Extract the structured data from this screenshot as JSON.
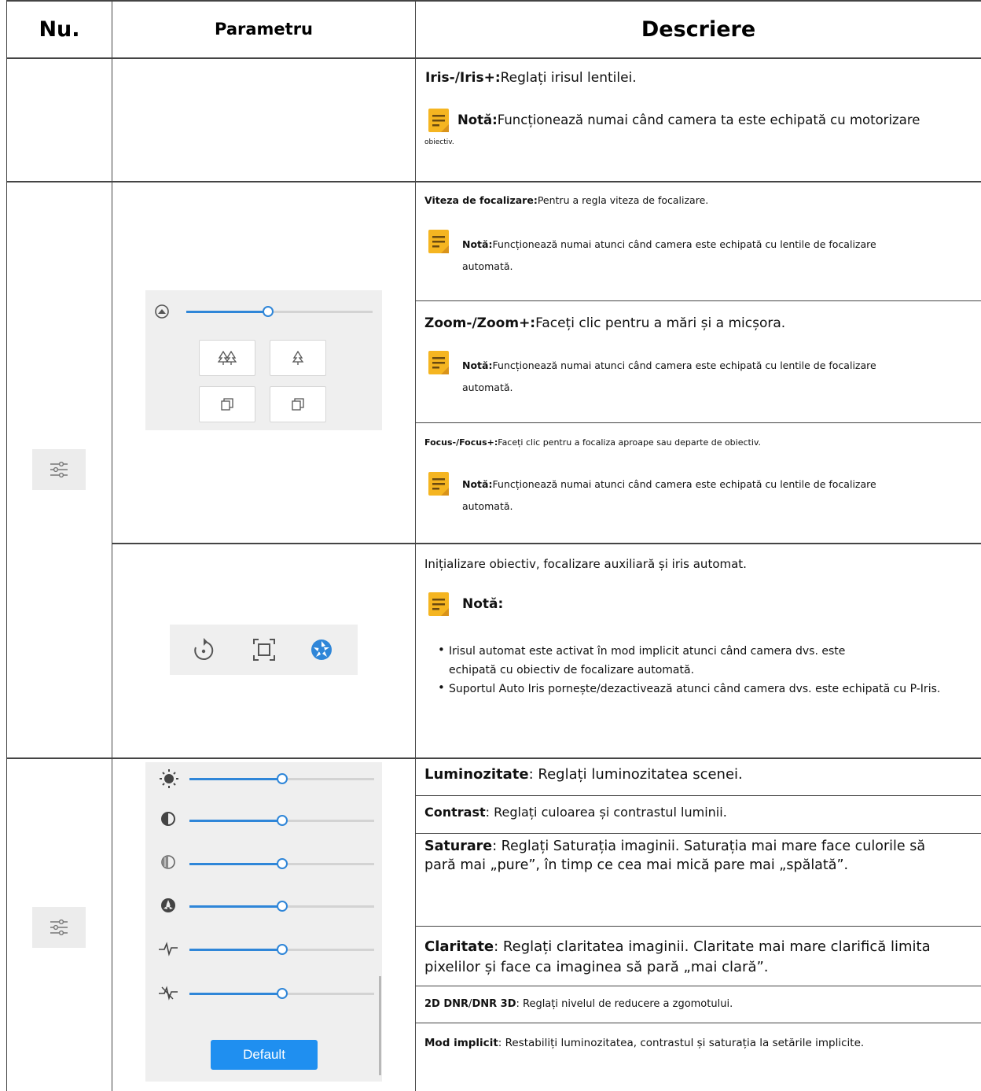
{
  "header": {
    "col_no": "Nu.",
    "col_param": "Parametru",
    "col_desc": "Descriere"
  },
  "rows": {
    "iris": {
      "label": "Iris-/Iris+:",
      "text": "Reglați irisul lentilei.",
      "note_label": "Notă:",
      "note_text": "Funcționează numai când camera ta este echipată cu motorizare",
      "note_cont": "obiectiv."
    },
    "focus_speed": {
      "label": "Viteza de focalizare:",
      "text": "Pentru a regla viteza de focalizare.",
      "note_label": "Notă:",
      "note_text": "Funcționează numai atunci când camera este echipată cu lentile de focalizare",
      "note_cont": "automată."
    },
    "zoom": {
      "label": "Zoom-/Zoom+:",
      "text": "Faceți clic pentru a mări și a micșora.",
      "note_label": "Notă:",
      "note_text": "Funcționează numai atunci când camera este echipată cu lentile de focalizare",
      "note_cont": "automată."
    },
    "focus": {
      "label": "Focus-/Focus+:",
      "text": "Faceți clic pentru a focaliza aproape sau departe de obiectiv.",
      "note_label": "Notă:",
      "note_text": "Funcționează numai atunci când camera este echipată cu lentile de focalizare",
      "note_cont": "automată."
    },
    "init": {
      "text": "Inițializare obiectiv, focalizare auxiliară și iris automat.",
      "note_label": "Notă:",
      "bullets": [
        "Irisul automat este activat în mod implicit atunci când camera dvs. este echipată cu obiectiv de focalizare automată.",
        "Suportul Auto Iris pornește/dezactivează atunci când camera dvs. este echipată cu P-Iris."
      ]
    },
    "brightness": {
      "label": "Luminozitate",
      "text": ": Reglați luminozitatea scenei."
    },
    "contrast": {
      "label": "Contrast",
      "text": ": Reglați culoarea și contrastul luminii."
    },
    "saturation": {
      "label": "Saturare",
      "text": ": Reglați Saturația imaginii. Saturația mai mare face culorile să pară mai „pure”, în timp ce cea mai mică pare mai „spălată”."
    },
    "sharpness": {
      "label": "Claritate",
      "text": ": Reglați claritatea imaginii. Claritate mai mare clarifică limita pixelilor și face ca imaginea să pară „mai clară”."
    },
    "dnr": {
      "label_a": "2D DNR",
      "sep": "/",
      "label_b": "DNR 3D",
      "text": ": Reglați nivelul de reducere a zgomotului."
    },
    "default": {
      "label": "Mod implicit",
      "text": ": Restabiliți luminozitatea, contrastul și saturația la setările implicite."
    }
  },
  "ui": {
    "focus_speed_slider": 0.44,
    "image_sliders": [
      0.5,
      0.5,
      0.5,
      0.5,
      0.5,
      0.5
    ],
    "default_button": "Default"
  },
  "colors": {
    "accent": "#2f86d8",
    "button": "#1f8ff0",
    "note_icon": "#f5b521"
  }
}
